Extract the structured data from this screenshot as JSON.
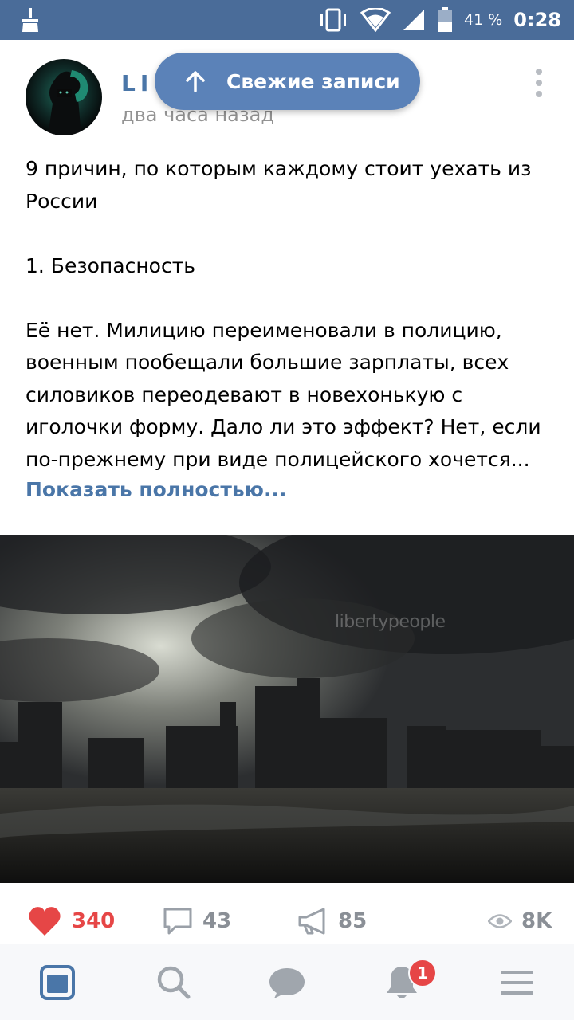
{
  "status_bar": {
    "battery_percent": "41 %",
    "time": "0:28",
    "icons": [
      "broom-icon",
      "vibrate-icon",
      "wifi-icon",
      "signal-icon",
      "battery-icon"
    ]
  },
  "post": {
    "author_name": "LI",
    "time_ago": "два часа назад",
    "text": "9 причин, по которым каждому стоит уехать из России\n\n1. Безопасность\n\nЕё нет. Милицию переименовали в полицию, военным пообещали большие зарплаты, всех силовиков переодевают в новехонькую с иголочки форму. Дало ли это эффект? Нет, если по-прежнему при виде полицейского хочется...",
    "show_more": "Показать полностью...",
    "image_watermark": "libertypeople",
    "likes": "340",
    "comments": "43",
    "shares": "85",
    "views": "8K"
  },
  "fresh_posts_button": {
    "label": "Свежие записи"
  },
  "bottom_nav": {
    "items": [
      "news-icon",
      "search-icon",
      "messages-icon",
      "notifications-icon",
      "menu-icon"
    ],
    "notifications_badge": "1"
  },
  "colors": {
    "status_bar": "#4a6c99",
    "accent": "#4a76a8",
    "pill": "#5b82b8",
    "like": "#e64646",
    "muted": "#8a8f96"
  }
}
